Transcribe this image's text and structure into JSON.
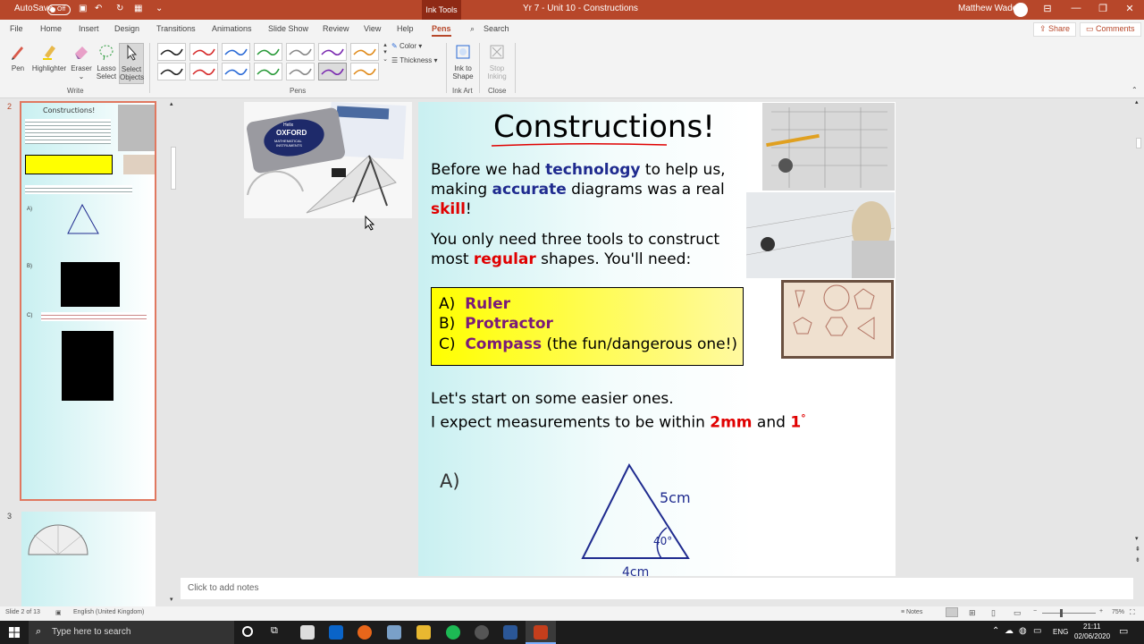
{
  "titlebar": {
    "autosave_label": "AutoSave",
    "autosave_state": "Off",
    "context_tab": "Ink Tools",
    "doc_title": "Yr 7 - Unit 10 - Constructions",
    "user": "Matthew Wade",
    "minimize": "—",
    "restore": "❐",
    "close": "✕",
    "ribbon_display": "⊟"
  },
  "menu": {
    "tabs": [
      "File",
      "Home",
      "Insert",
      "Design",
      "Transitions",
      "Animations",
      "Slide Show",
      "Review",
      "View",
      "Help",
      "Pens"
    ],
    "search": "Search",
    "share": "Share",
    "comments": "Comments"
  },
  "ribbon": {
    "pen": "Pen",
    "highlighter": "Highlighter",
    "eraser": "Eraser",
    "lasso_select": [
      "Lasso",
      "Select"
    ],
    "select_objects": [
      "Select",
      "Objects"
    ],
    "group_write": "Write",
    "color": "Color",
    "thickness": "Thickness",
    "group_pens": "Pens",
    "ink_to_shape": [
      "Ink to",
      "Shape"
    ],
    "group_ink_art": "Ink Art",
    "stop_inking": [
      "Stop",
      "Inking"
    ],
    "group_close": "Close",
    "pen_colors": [
      "#222222",
      "#d62a2a",
      "#2a6ad6",
      "#2a9a3a",
      "#888888",
      "#7a2ab0",
      "#e08a1a",
      "#222222",
      "#d62a2a",
      "#2a6ad6",
      "#2a9a3a",
      "#888888",
      "#7a2ab0",
      "#e08a1a"
    ]
  },
  "thumbnails": {
    "slide2_num": "2",
    "slide3_num": "3",
    "mini_title": "Constructions!",
    "mini_a": "A)",
    "mini_b": "B)",
    "mini_c": "C)"
  },
  "slide": {
    "title": "Constructions!",
    "p1_a": "Before we had ",
    "p1_tech": "technology",
    "p1_b": " to help us,",
    "p1_c": "making ",
    "p1_accurate": "accurate",
    "p1_d": " diagrams was a real",
    "p1_skill": "skill",
    "p1_e": "!",
    "p2_a": "You only need three tools to construct",
    "p2_b": "most ",
    "p2_regular": "regular",
    "p2_c": " shapes.  You'll need:",
    "tool_a_letter": "A)",
    "tool_a": "Ruler",
    "tool_b_letter": "B)",
    "tool_b": "Protractor",
    "tool_c_letter": "C)",
    "tool_c": "Compass",
    "tool_c_note": " (the fun/dangerous one!)",
    "p3_a": "Let's start on some easier ones.",
    "p3_b": "I expect measurements to be within ",
    "p3_2mm": "2mm",
    "p3_and": " and ",
    "p3_1": "1",
    "p3_deg": "°",
    "q_a": "A)",
    "side_label": "5cm",
    "angle_label": "40°",
    "base_label": "4cm",
    "tin_brand_1": "Helix",
    "tin_brand_2": "OXFORD",
    "tin_brand_3": "MATHEMATICAL",
    "tin_brand_4": "INSTRUMENTS"
  },
  "notes": {
    "placeholder": "Click to add notes"
  },
  "status": {
    "slide_of": "Slide 2 of 13",
    "language": "English (United Kingdom)",
    "notes_btn": "Notes",
    "zoom": "75%"
  },
  "taskbar": {
    "search_placeholder": "Type here to search",
    "lang": "ENG",
    "time": "21:11",
    "date": "02/06/2020"
  }
}
